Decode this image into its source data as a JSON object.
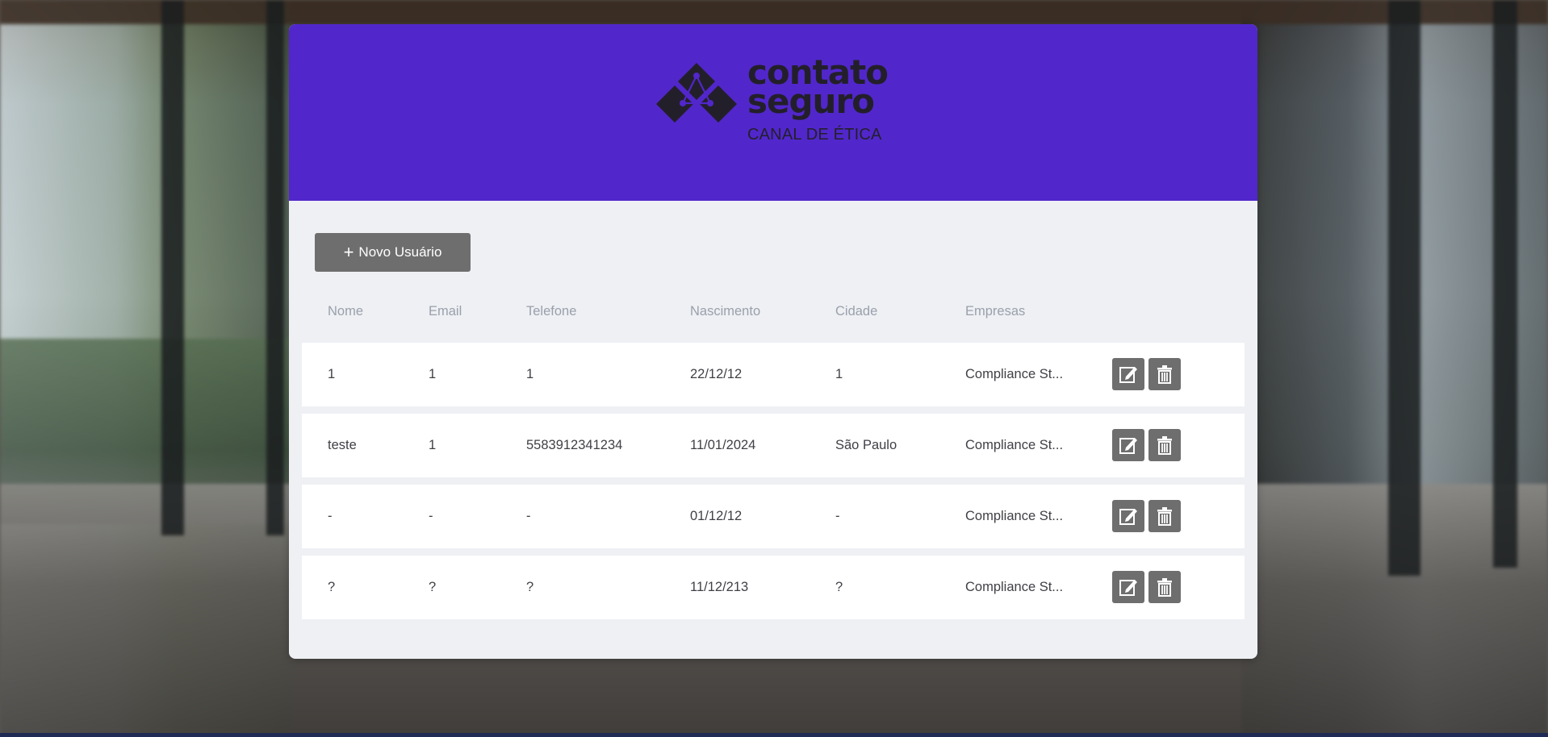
{
  "brand": {
    "name_line1": "contato",
    "name_line2": "seguro",
    "tagline": "CANAL DE ÉTICA"
  },
  "toolbar": {
    "new_user_label": "Novo Usuário"
  },
  "table": {
    "headers": [
      "Nome",
      "Email",
      "Telefone",
      "Nascimento",
      "Cidade",
      "Empresas"
    ],
    "rows": [
      {
        "nome": "1",
        "email": "1",
        "telefone": "1",
        "nascimento": "22/12/12",
        "cidade": "1",
        "empresas": "Compliance St..."
      },
      {
        "nome": "teste",
        "email": "1",
        "telefone": "5583912341234",
        "nascimento": "11/01/2024",
        "cidade": "São Paulo",
        "empresas": "Compliance St..."
      },
      {
        "nome": "-",
        "email": "-",
        "telefone": "-",
        "nascimento": "01/12/12",
        "cidade": "-",
        "empresas": "Compliance St..."
      },
      {
        "nome": "?",
        "email": "?",
        "telefone": "?",
        "nascimento": "11/12/213",
        "cidade": "?",
        "empresas": "Compliance St..."
      }
    ]
  },
  "colors": {
    "header_bg": "#5127cb",
    "button_bg": "#6e6e6e",
    "panel_bg": "#eef0f4"
  },
  "icons": [
    "plus-icon",
    "edit-icon",
    "trash-icon",
    "logo-mark"
  ]
}
